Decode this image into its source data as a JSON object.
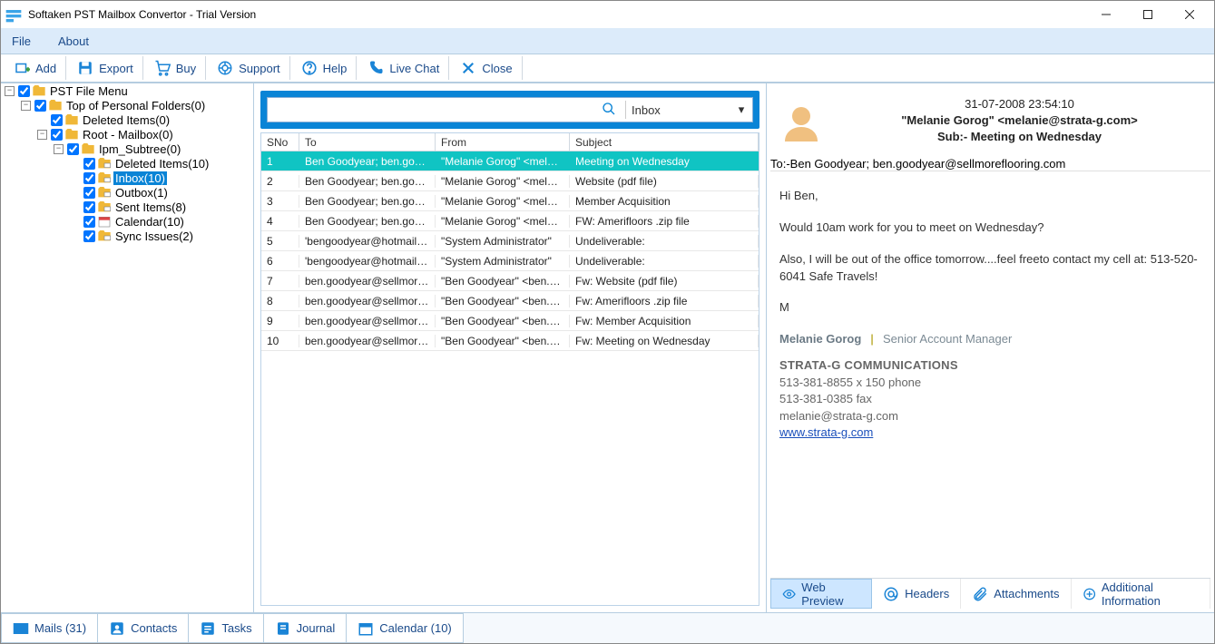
{
  "title": "Softaken PST Mailbox Convertor - Trial Version",
  "menu": {
    "file": "File",
    "about": "About"
  },
  "toolbar": {
    "add": "Add",
    "export": "Export",
    "buy": "Buy",
    "support": "Support",
    "help": "Help",
    "livechat": "Live Chat",
    "close": "Close"
  },
  "tree": {
    "root": "PST File Menu",
    "top": "Top of Personal Folders(0)",
    "del0": "Deleted Items(0)",
    "rootmb": "Root - Mailbox(0)",
    "ipm": "Ipm_Subtree(0)",
    "del10": "Deleted Items(10)",
    "inbox": "Inbox(10)",
    "outbox": "Outbox(1)",
    "sent": "Sent Items(8)",
    "cal": "Calendar(10)",
    "sync": "Sync Issues(2)"
  },
  "search": {
    "placeholder": "",
    "folder": "Inbox"
  },
  "gridhead": {
    "sno": "SNo",
    "to": "To",
    "from": "From",
    "subject": "Subject"
  },
  "rows": [
    {
      "sno": "1",
      "to": "Ben Goodyear; ben.goodye...",
      "from": "\"Melanie Gorog\" <melanie...",
      "subject": "Meeting on Wednesday"
    },
    {
      "sno": "2",
      "to": "Ben Goodyear; ben.goodye...",
      "from": "\"Melanie Gorog\" <melanie...",
      "subject": "Website (pdf file)"
    },
    {
      "sno": "3",
      "to": "Ben Goodyear; ben.goodye...",
      "from": "\"Melanie Gorog\" <melanie...",
      "subject": "Member Acquisition"
    },
    {
      "sno": "4",
      "to": "Ben Goodyear; ben.goodye...",
      "from": "\"Melanie Gorog\" <melanie...",
      "subject": "FW: Amerifloors .zip file"
    },
    {
      "sno": "5",
      "to": "'bengoodyear@hotmail.com'",
      "from": "\"System Administrator\"",
      "subject": "Undeliverable:"
    },
    {
      "sno": "6",
      "to": "'bengoodyear@hotmail.com'",
      "from": "\"System Administrator\"",
      "subject": "Undeliverable:"
    },
    {
      "sno": "7",
      "to": "ben.goodyear@sellmorefloo...",
      "from": "\"Ben Goodyear\" <ben.good...",
      "subject": "Fw: Website (pdf file)"
    },
    {
      "sno": "8",
      "to": "ben.goodyear@sellmorefloo...",
      "from": "\"Ben Goodyear\" <ben.good...",
      "subject": "Fw: Amerifloors .zip file"
    },
    {
      "sno": "9",
      "to": "ben.goodyear@sellmorefloo...",
      "from": "\"Ben Goodyear\" <ben.good...",
      "subject": "Fw: Member Acquisition"
    },
    {
      "sno": "10",
      "to": "ben.goodyear@sellmorefloo...",
      "from": "\"Ben Goodyear\" <ben.good...",
      "subject": "Fw: Meeting on Wednesday"
    }
  ],
  "preview": {
    "date": "31-07-2008 23:54:10",
    "from": "\"Melanie Gorog\" <melanie@strata-g.com>",
    "subject": "Sub:- Meeting on Wednesday",
    "to": "To:-Ben Goodyear; ben.goodyear@sellmoreflooring.com",
    "body": {
      "l1": "Hi Ben,",
      "l2": "Would 10am work for you to meet on Wednesday?",
      "l3": "Also, I will be out of the office tomorrow....feel freeto contact my cell at:  513-520-6041  Safe Travels!",
      "l4": "M"
    },
    "sig": {
      "name": "Melanie Gorog",
      "role": "Senior Account Manager",
      "company": "STRATA-G COMMUNICATIONS",
      "phone": "513-381-8855 x 150 phone",
      "fax": "513-381-0385 fax",
      "email": "melanie@strata-g.com",
      "url": "www.strata-g.com"
    }
  },
  "ptabs": {
    "web": "Web Preview",
    "headers": "Headers",
    "attach": "Attachments",
    "add": "Additional Information"
  },
  "footer": {
    "mails": "Mails (31)",
    "contacts": "Contacts",
    "tasks": "Tasks",
    "journal": "Journal",
    "calendar": "Calendar (10)"
  }
}
